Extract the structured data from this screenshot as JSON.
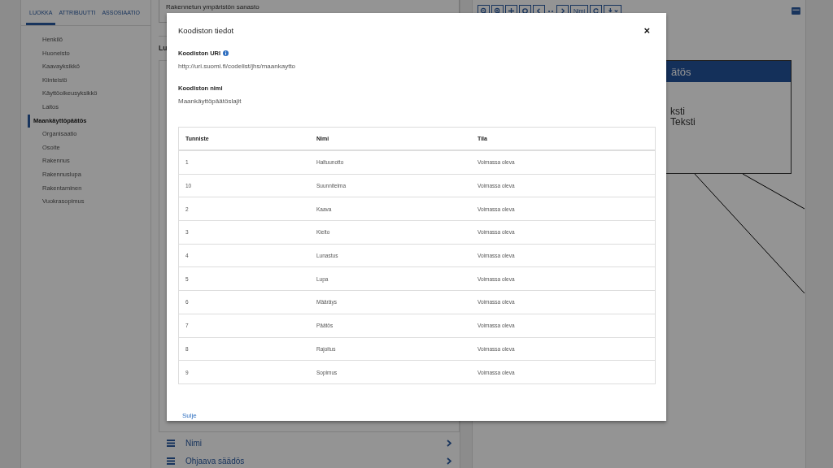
{
  "sidebar": {
    "tabs": [
      {
        "label": "LUOKKA",
        "selected": true
      },
      {
        "label": "ATTRIBUUTTI",
        "selected": false
      },
      {
        "label": "ASSOSIAATIO",
        "selected": false
      }
    ],
    "items": [
      {
        "label": "Henkilö",
        "selected": false
      },
      {
        "label": "Huoneisto",
        "selected": false
      },
      {
        "label": "Kaavayksikkö",
        "selected": false
      },
      {
        "label": "Kiinteistö",
        "selected": false
      },
      {
        "label": "Käyttöoikeusyksikkö",
        "selected": false
      },
      {
        "label": "Laitos",
        "selected": false
      },
      {
        "label": "Maankäyttöpäätös",
        "selected": true
      },
      {
        "label": "Organisaatio",
        "selected": false
      },
      {
        "label": "Osoite",
        "selected": false
      },
      {
        "label": "Rakennus",
        "selected": false
      },
      {
        "label": "Rakennuslupa",
        "selected": false
      },
      {
        "label": "Rakentaminen",
        "selected": false
      },
      {
        "label": "Vuokrasopimus",
        "selected": false
      }
    ]
  },
  "vocabulary": {
    "value": "Rakennetun ympäristön sanasto"
  },
  "section_label": "Lu",
  "properties": [
    {
      "label": "Nimi"
    },
    {
      "label": "Ohjaava säädös"
    }
  ],
  "diagram": {
    "toolbar_label": "Nimi",
    "class_title": "ätös",
    "attributes": [
      "ksti",
      "Teksti"
    ]
  },
  "modal": {
    "title": "Koodiston tiedot",
    "close": "×",
    "uri_label": "Koodiston URI",
    "uri": "http://uri.suomi.fi/codelist/jhs/maankaytto",
    "name_label": "Koodiston nimi",
    "name": "Maankäyttöpäätöslajit",
    "columns": [
      "Tunniste",
      "Nimi",
      "Tila"
    ],
    "rows": [
      [
        "1",
        "Haltuunotto",
        "Voimassa oleva"
      ],
      [
        "10",
        "Suunnitelma",
        "Voimassa oleva"
      ],
      [
        "2",
        "Kaava",
        "Voimassa oleva"
      ],
      [
        "3",
        "Kielto",
        "Voimassa oleva"
      ],
      [
        "4",
        "Lunastus",
        "Voimassa oleva"
      ],
      [
        "5",
        "Lupa",
        "Voimassa oleva"
      ],
      [
        "6",
        "Määräys",
        "Voimassa oleva"
      ],
      [
        "7",
        "Päätös",
        "Voimassa oleva"
      ],
      [
        "8",
        "Rajoitus",
        "Voimassa oleva"
      ],
      [
        "9",
        "Sopimus",
        "Voimassa oleva"
      ]
    ],
    "close_link": "Sulje"
  }
}
